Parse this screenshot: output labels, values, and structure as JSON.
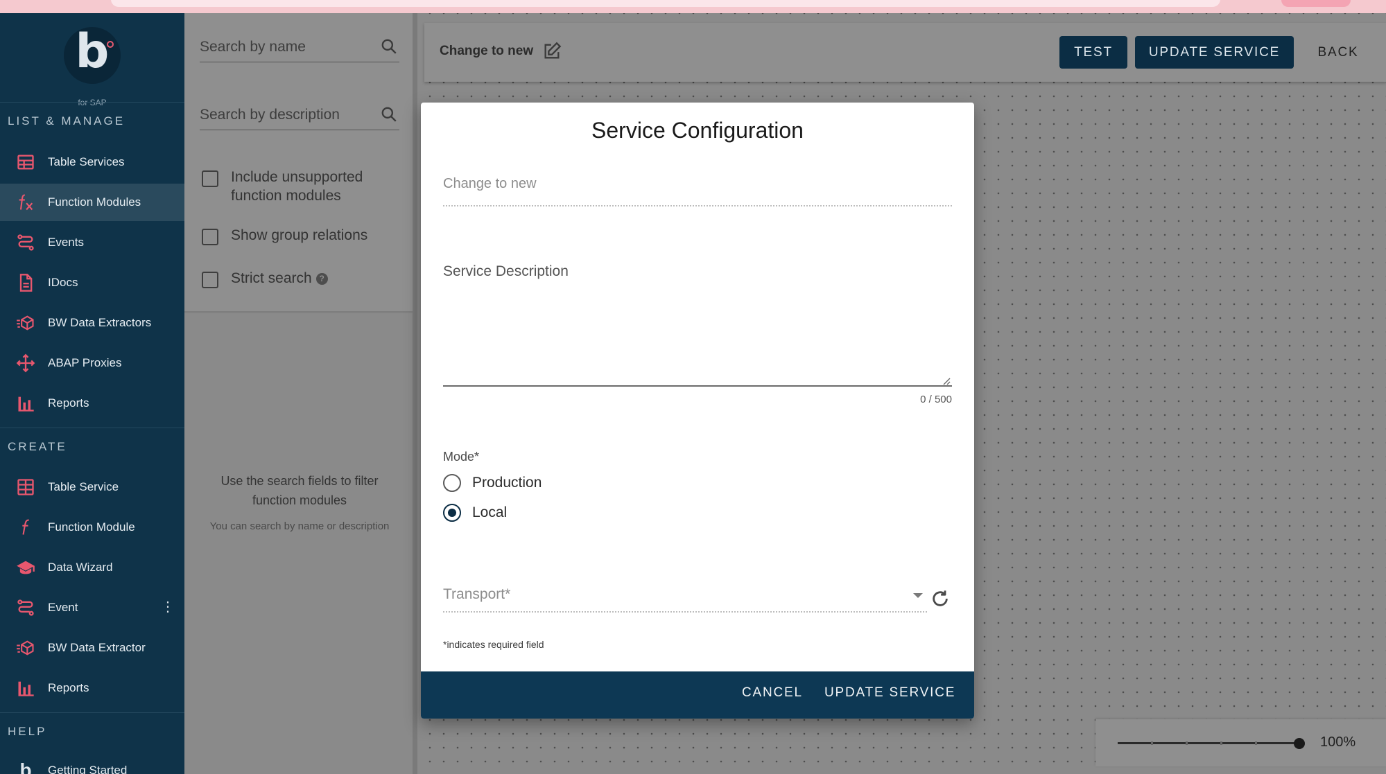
{
  "logo": {
    "letter": "b",
    "sub": "for SAP"
  },
  "sidebar": {
    "sections": {
      "list_manage": "LIST & MANAGE",
      "create": "CREATE",
      "help": "HELP"
    },
    "list_manage_items": [
      {
        "label": "Table Services",
        "icon": "table-icon"
      },
      {
        "label": "Function Modules",
        "icon": "function-fx-icon",
        "active": true
      },
      {
        "label": "Events",
        "icon": "events-route-icon"
      },
      {
        "label": "IDocs",
        "icon": "document-icon"
      },
      {
        "label": "BW Data Extractors",
        "icon": "cube-extractor-icon"
      },
      {
        "label": "ABAP Proxies",
        "icon": "proxy-arrows-icon"
      },
      {
        "label": "Reports",
        "icon": "bar-chart-icon"
      }
    ],
    "create_items": [
      {
        "label": "Table Service",
        "icon": "table-add-icon"
      },
      {
        "label": "Function Module",
        "icon": "function-f-icon"
      },
      {
        "label": "Data Wizard",
        "icon": "wizard-hat-icon"
      },
      {
        "label": "Event",
        "icon": "events-route-icon"
      },
      {
        "label": "BW Data Extractor",
        "icon": "cube-extractor-icon"
      },
      {
        "label": "Reports",
        "icon": "bar-chart-icon"
      }
    ],
    "help_items": [
      {
        "label": "Getting Started",
        "icon": "b-logo-icon"
      }
    ]
  },
  "search_panel": {
    "name_placeholder": "Search by name",
    "description_placeholder": "Search by description",
    "checkboxes": {
      "unsupported": "Include unsupported function modules",
      "group_relations": "Show group relations",
      "strict": "Strict search"
    },
    "hint_main": "Use the search fields to filter function modules",
    "hint_sub": "You can search by name or description"
  },
  "toolbar": {
    "title": "Change to new",
    "test_label": "TEST",
    "update_label": "UPDATE SERVICE",
    "back_label": "BACK"
  },
  "zoom": {
    "value_label": "100%",
    "value": 100
  },
  "modal": {
    "title": "Service Configuration",
    "name_value": "Change to new",
    "description_label": "Service Description",
    "description_value": "",
    "counter": "0 / 500",
    "mode_label": "Mode*",
    "mode_options": [
      "Production",
      "Local"
    ],
    "mode_selected": "Local",
    "transport_label": "Transport*",
    "required_note": "*indicates required field",
    "cancel_label": "CANCEL",
    "update_label": "UPDATE SERVICE"
  },
  "colors": {
    "sidebar_bg": "#0f3349",
    "icon_accent": "#e8576e",
    "primary_button": "#0b2d44",
    "modal_footer": "#0d3854"
  }
}
